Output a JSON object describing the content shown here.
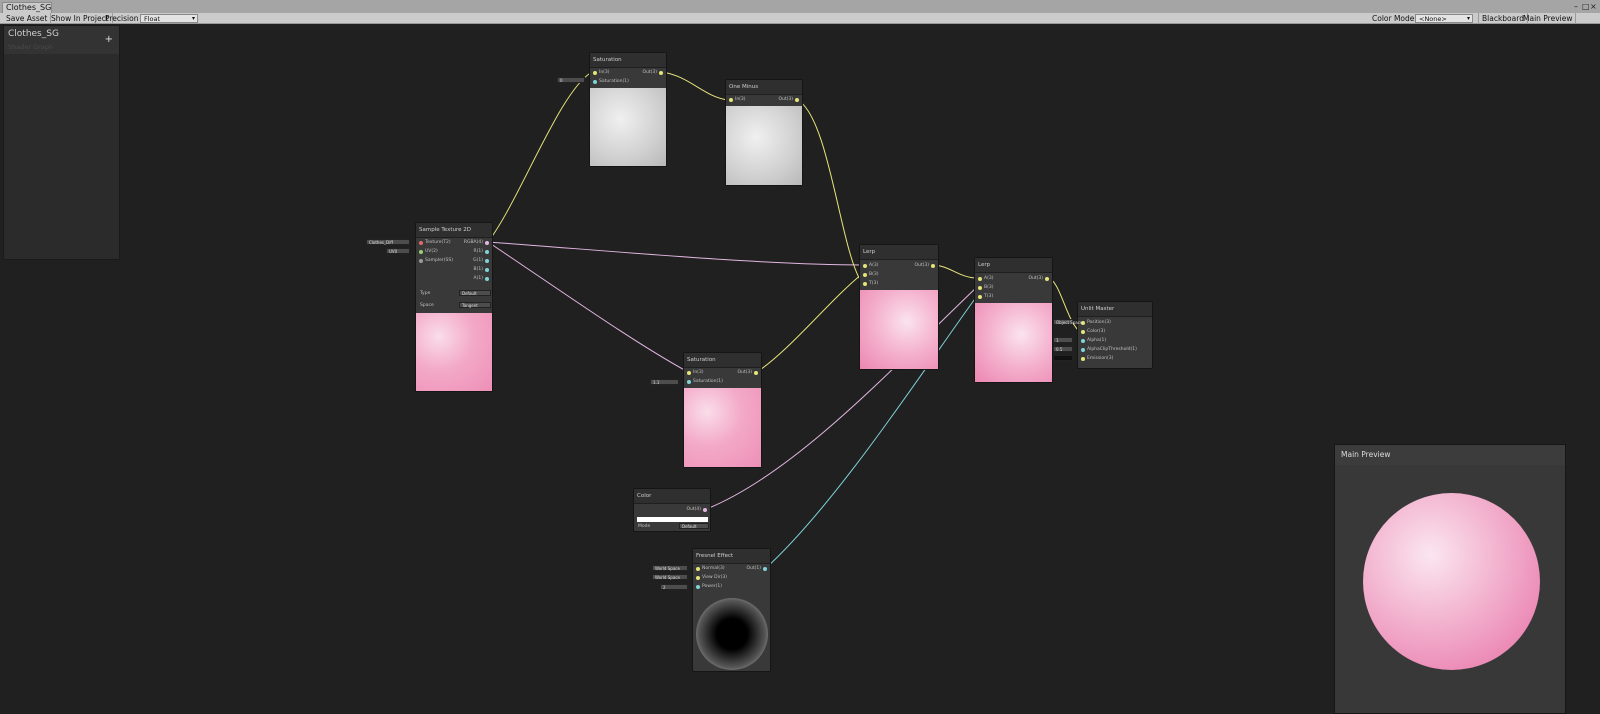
{
  "window": {
    "tab_title": "Clothes_SG",
    "controls": [
      "-",
      "□",
      "×"
    ]
  },
  "toolbar": {
    "save_asset": "Save Asset",
    "show_in_project": "Show In Project",
    "precision_label": "Precision",
    "precision_value": "Float",
    "color_mode_label": "Color Mode",
    "color_mode_value": "<None>",
    "blackboard": "Blackboard",
    "main_preview": "Main Preview"
  },
  "blackboard": {
    "title": "Clothes_SG",
    "subtitle": "Shader Graph",
    "add": "+"
  },
  "nodes": {
    "saturation_top": {
      "title": "Saturation",
      "in": "In(3)",
      "sat": "Saturation(1)",
      "out": "Out(3)",
      "field": "0"
    },
    "one_minus": {
      "title": "One Minus",
      "in": "In(3)",
      "out": "Out(3)"
    },
    "sample_texture": {
      "title": "Sample Texture 2D",
      "texture": "Texture(T2)",
      "uv": "UV(2)",
      "sampler": "Sampler(SS)",
      "rgba": "RGBA(4)",
      "r": "R(1)",
      "g": "G(1)",
      "b": "B(1)",
      "a": "A(1)",
      "type_label": "Type",
      "type_value": "Default",
      "space_label": "Space",
      "space_value": "Tangent",
      "texture_field": "Clothes_Diff",
      "uv_field": "UV0"
    },
    "lerp_1": {
      "title": "Lerp",
      "a": "A(3)",
      "b": "B(3)",
      "t": "T(3)",
      "out": "Out(3)"
    },
    "lerp_2": {
      "title": "Lerp",
      "a": "A(3)",
      "b": "B(3)",
      "t": "T(3)",
      "out": "Out(3)"
    },
    "unlit_master": {
      "title": "Unlit Master",
      "position": "Position(3)",
      "color": "Color(3)",
      "alpha": "Alpha(1)",
      "alpha_clip": "AlphaClipThreshold(1)",
      "emission": "Emission(3)",
      "space_field": "Object Space",
      "alpha_field": "1",
      "clip_field": "0.5"
    },
    "saturation_mid": {
      "title": "Saturation",
      "in": "In(3)",
      "sat": "Saturation(1)",
      "out": "Out(3)",
      "field": "1.1"
    },
    "color": {
      "title": "Color",
      "out": "Out(4)",
      "mode_label": "Mode",
      "mode_value": "Default"
    },
    "fresnel": {
      "title": "Fresnel Effect",
      "normal": "Normal(3)",
      "view": "View Dir(3)",
      "power": "Power(1)",
      "out": "Out(1)",
      "normal_field": "World Space",
      "view_field": "World Space",
      "power_field": "2"
    }
  },
  "main_preview": {
    "title": "Main Preview"
  },
  "colors": {
    "vec3": "#e6e47a",
    "vec4": "#e3b7e2",
    "vec1": "#7fd4d8",
    "graph_bg": "#202020",
    "node": "#393939"
  }
}
